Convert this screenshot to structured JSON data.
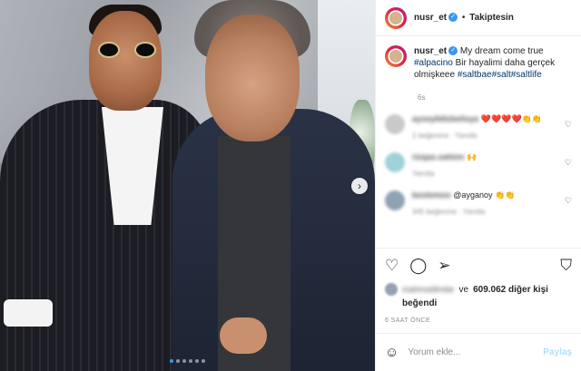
{
  "post": {
    "username": "nusr_et",
    "verified_mark": "✓",
    "separator": "•",
    "follow_state": "Takiptesin",
    "more_icon": "more-horizontal-icon",
    "caption": {
      "username": "nusr_et",
      "text_1": "My dream come true",
      "tag_1": "#alpacino",
      "text_2": " Bir hayalimi daha gerçek olmişkeee ",
      "tag_2": "#saltbae",
      "tag_3": "#salt",
      "tag_4": "#saltlife"
    },
    "caption_age": "6s",
    "comments": [
      {
        "user": "ayseyildizbelisya",
        "text": "❤️❤️❤️❤️👏👏",
        "meta": "1 beğenme · Yanıtla",
        "avatar_color": "#c9c9c9"
      },
      {
        "user": "rizqas.sahinn",
        "text": "🙌",
        "meta": "Yanıtla",
        "avatar_color": "#9fd2d8"
      },
      {
        "user": "bestemoo",
        "text": "@ayganoy 👏👏",
        "meta": "345 beğenme · Yanıtla",
        "avatar_color": "#8fa3b5"
      }
    ],
    "likes": {
      "prefix_blurred": "mahmutdindar",
      "connector": "ve",
      "count_text": "609.062 diğer kişi",
      "suffix": "beğendi"
    },
    "timestamp": "6 SAAT ÖNCE",
    "comment_input": {
      "placeholder": "Yorum ekle...",
      "post_label": "Paylaş",
      "emoji_icon": "emoji-icon"
    }
  },
  "photo": {
    "carousel_dots": 6,
    "active_dot_index": 0,
    "next_icon": "chevron-right-icon"
  },
  "colors": {
    "link": "#00376b",
    "verified": "#3897f0",
    "muted": "#8e8e8e",
    "post_btn_disabled": "#b2dffc"
  }
}
